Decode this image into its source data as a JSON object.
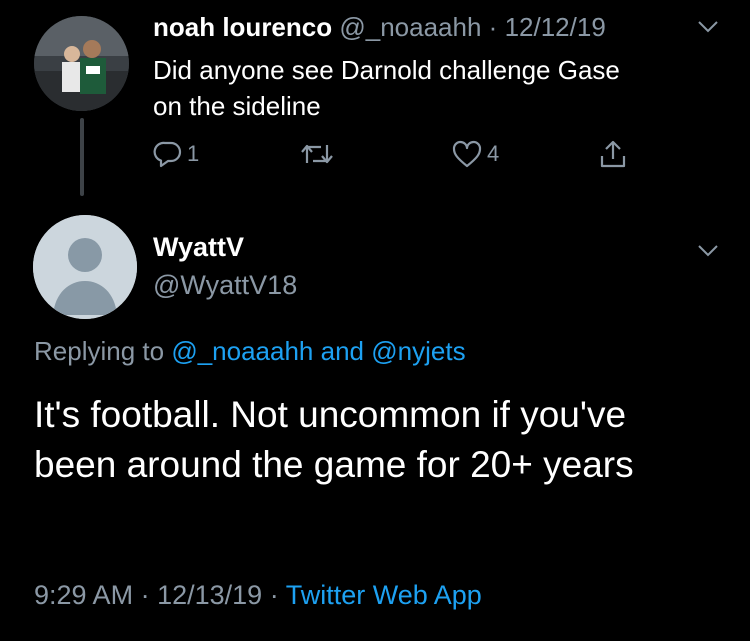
{
  "tweet": {
    "author_name": "noah lourenco",
    "author_handle": "@_noaaahh",
    "separator": "·",
    "date": "12/12/19",
    "body_line1": "Did anyone see Darnold challenge Gase",
    "body_line2": "on the sideline",
    "reply_count": "1",
    "like_count": "4",
    "icons": [
      "reply-icon",
      "retweet-icon",
      "like-icon",
      "share-icon",
      "chevron-down-icon"
    ]
  },
  "reply": {
    "author_name": "WyattV",
    "author_handle": "@WyattV18",
    "replying_prefix": "Replying to",
    "replying_user1": "@_noaaahh",
    "replying_and": "and",
    "replying_user2": "@nyjets",
    "text_line1": "It's football. Not uncommon if you've",
    "text_line2": "been around the game for 20+ years",
    "time": "9:29 AM",
    "date": "12/13/19",
    "separator": "·",
    "source": "Twitter Web App"
  },
  "colors": {
    "background": "#000000",
    "text": "#ffffff",
    "muted": "#8b98a5",
    "link": "#1da1f2"
  }
}
